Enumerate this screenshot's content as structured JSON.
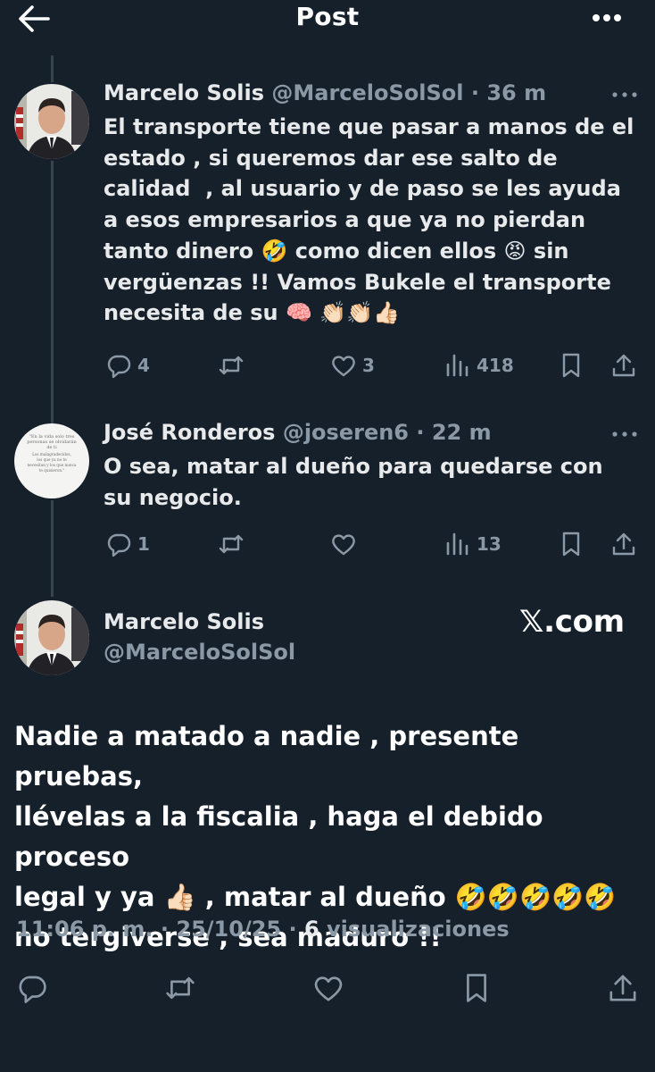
{
  "header": {
    "title": "Post"
  },
  "tweets": [
    {
      "name": "Marcelo Solis",
      "handle": "@MarceloSolSol",
      "sep": "·",
      "time": "36 m",
      "text": "El transporte tiene que pasar a manos de el\nestado , si queremos dar ese salto de\ncalidad  , al usuario y de paso se les ayuda\na esos empresarios a que ya no pierdan\ntanto dinero 🤣 como dicen ellos 😡 sin\nvergüenzas !! Vamos Bukele el transporte\nnecesita de su 🧠 👏🏻👏🏻👍🏻",
      "replies": "4",
      "reposts": "",
      "likes": "3",
      "views": "418"
    },
    {
      "name": "José Ronderos",
      "handle": "@joseren6",
      "sep": "·",
      "time": "22 m",
      "text": "O sea, matar al dueño para quedarse con\nsu negocio.",
      "replies": "1",
      "reposts": "",
      "likes": "",
      "views": "13",
      "avatar_quote": "\"En la vida solo tres personas se olvidarán de ti. Los malagradecidos, los que ya no te necesitan y los que nunca te quisieron.\""
    }
  ],
  "main": {
    "name": "Marcelo Solis",
    "handle": "@MarceloSolSol",
    "watermark": "𝕏.com",
    "text": "Nadie a matado a nadie , presente pruebas,\nllévelas a la fiscalia , haga el debido proceso\nlegal y ya 👍🏻 , matar al dueño 🤣🤣🤣🤣🤣\nno tergiverse , sea maduro !!",
    "time": "11:06 p. m.",
    "sep": "·",
    "date": "25/10/25",
    "views_count": "6",
    "views_label": "visualizaciones"
  },
  "icons": {
    "back": "arrow-left-icon",
    "more": "more-horizontal-icon",
    "reply": "reply-icon",
    "repost": "repost-icon",
    "like": "heart-icon",
    "views": "views-bar-icon",
    "bookmark": "bookmark-icon",
    "share": "share-icon"
  },
  "colors": {
    "background": "#15202b",
    "text": "#e7e9ea",
    "muted": "#8b98a5",
    "divider": "#38444d"
  }
}
